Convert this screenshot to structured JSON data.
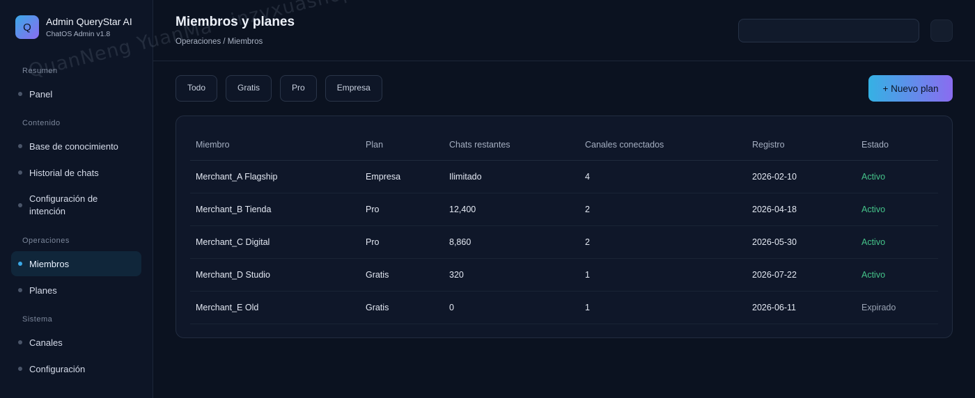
{
  "brand": {
    "logo_letter": "Q",
    "title": "Admin QueryStar AI",
    "subtitle": "ChatOS Admin v1.8"
  },
  "sidebar": {
    "sections": [
      {
        "label": "Resumen",
        "items": [
          {
            "label": "Panel",
            "active": false
          }
        ]
      },
      {
        "label": "Contenido",
        "items": [
          {
            "label": "Base de conocimiento",
            "active": false
          },
          {
            "label": "Historial de chats",
            "active": false
          },
          {
            "label": "Configuración de intención",
            "active": false
          }
        ]
      },
      {
        "label": "Operaciones",
        "items": [
          {
            "label": "Miembros",
            "active": true
          },
          {
            "label": "Planes",
            "active": false
          }
        ]
      },
      {
        "label": "Sistema",
        "items": [
          {
            "label": "Canales",
            "active": false
          },
          {
            "label": "Configuración",
            "active": false
          }
        ]
      }
    ]
  },
  "header": {
    "title": "Miembros y planes",
    "breadcrumb": "Operaciones / Miembros",
    "search_value": ""
  },
  "filters": [
    "Todo",
    "Gratis",
    "Pro",
    "Empresa"
  ],
  "new_plan_label": "+ Nuevo plan",
  "table": {
    "columns": [
      "Miembro",
      "Plan",
      "Chats restantes",
      "Canales conectados",
      "Registro",
      "Estado"
    ],
    "rows": [
      [
        "Merchant_A Flagship",
        "Empresa",
        "Ilimitado",
        "4",
        "2026-02-10",
        "Activo"
      ],
      [
        "Merchant_B Tienda",
        "Pro",
        "12,400",
        "2",
        "2026-04-18",
        "Activo"
      ],
      [
        "Merchant_C Digital",
        "Pro",
        "8,860",
        "2",
        "2026-05-30",
        "Activo"
      ],
      [
        "Merchant_D Studio",
        "Gratis",
        "320",
        "1",
        "2026-07-22",
        "Activo"
      ],
      [
        "Merchant_E Old",
        "Gratis",
        "0",
        "1",
        "2026-06-11",
        "Expirado"
      ]
    ]
  },
  "watermark": "QuanNeng YuanMa · inzyxuashop.com",
  "colors": {
    "accent": "#3aa8e6",
    "status_active": "#45c48a",
    "status_expired": "#9aa3b3"
  }
}
